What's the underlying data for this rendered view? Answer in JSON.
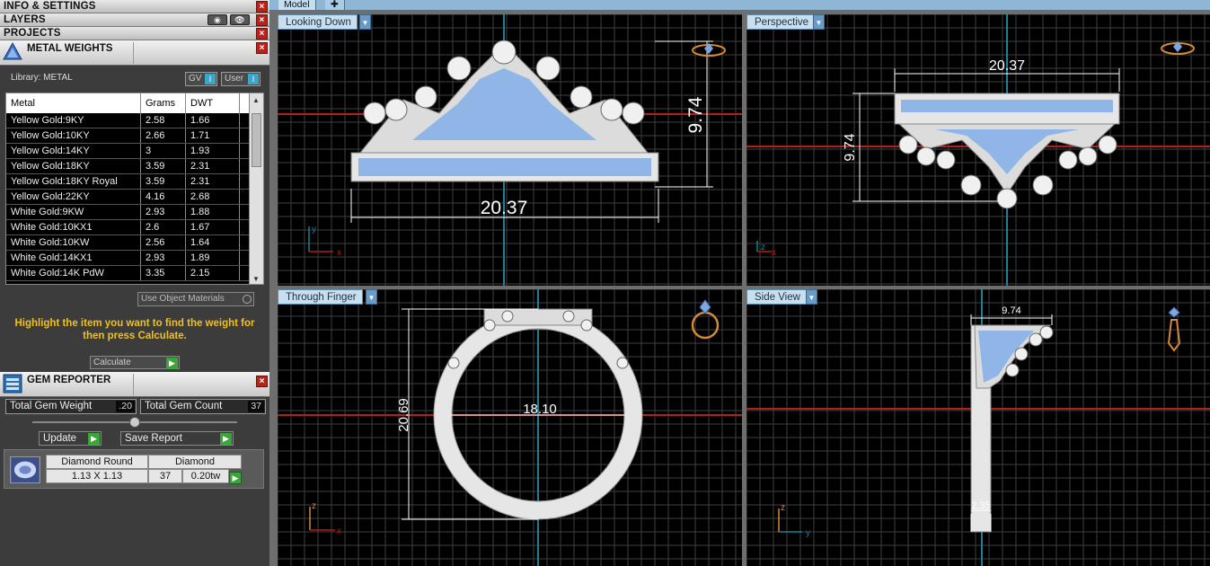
{
  "panels": {
    "info_settings": "INFO & SETTINGS",
    "layers": "LAYERS",
    "projects": "PROJECTS",
    "close_glyph": "×"
  },
  "metal_weights": {
    "title": "METAL WEIGHTS",
    "library_label": "Library: METAL",
    "gv_label": "GV",
    "user_label": "User",
    "columns": [
      "Metal",
      "Grams",
      "DWT"
    ],
    "rows": [
      [
        "Yellow Gold:9KY",
        "2.58",
        "1.66"
      ],
      [
        "Yellow Gold:10KY",
        "2.66",
        "1.71"
      ],
      [
        "Yellow Gold:14KY",
        "3",
        "1.93"
      ],
      [
        "Yellow Gold:18KY",
        "3.59",
        "2.31"
      ],
      [
        "Yellow Gold:18KY Royal",
        "3.59",
        "2.31"
      ],
      [
        "Yellow Gold:22KY",
        "4.16",
        "2.68"
      ],
      [
        "White Gold:9KW",
        "2.93",
        "1.88"
      ],
      [
        "White Gold:10KX1",
        "2.6",
        "1.67"
      ],
      [
        "White Gold:10KW",
        "2.56",
        "1.64"
      ],
      [
        "White Gold:14KX1",
        "2.93",
        "1.89"
      ],
      [
        "White Gold:14K PdW",
        "3.35",
        "2.15"
      ]
    ],
    "use_object_materials": "Use Object Materials",
    "hint": "Highlight the item you want to find the weight for then press Calculate.",
    "calculate_label": "Calculate"
  },
  "gem_reporter": {
    "title": "GEM REPORTER",
    "total_weight_label": "Total Gem Weight",
    "total_weight_value": ".20",
    "total_count_label": "Total Gem Count",
    "total_count_value": "37",
    "update_label": "Update",
    "save_report_label": "Save Report",
    "gem": {
      "name": "Diamond Round",
      "size": "1.13 X 1.13",
      "material": "Diamond",
      "count": "37",
      "weight": "0.20tw"
    }
  },
  "tabs": [
    {
      "label": "Model",
      "active": true
    },
    {
      "label": "✚",
      "active": false
    }
  ],
  "viewports": {
    "looking_down": {
      "label": "Looking Down",
      "dim_width": "20.37",
      "dim_height": "9.74",
      "axis_a": "y",
      "axis_b": "x"
    },
    "perspective": {
      "label": "Perspective",
      "dim_width": "20.37",
      "dim_height": "9.74",
      "axis_a": "z",
      "axis_b": "x"
    },
    "through_finger": {
      "label": "Through Finger",
      "dim_height": "20.69",
      "dim_inner": "18.10",
      "axis_a": "z",
      "axis_b": "x"
    },
    "side_view": {
      "label": "Side View",
      "dim_top": "9.74",
      "dim_bottom": "2.35",
      "axis_a": "z",
      "axis_b": "y"
    }
  },
  "colors": {
    "gem_blue": "#8fb6e6",
    "metal_white": "#eeeeee",
    "grid": "#3f3f3f",
    "axis_red": "#b31e1e",
    "axis_teal": "#1e7f96",
    "hint_yellow": "#f2c01e",
    "icon_orange": "#d28a3a"
  }
}
